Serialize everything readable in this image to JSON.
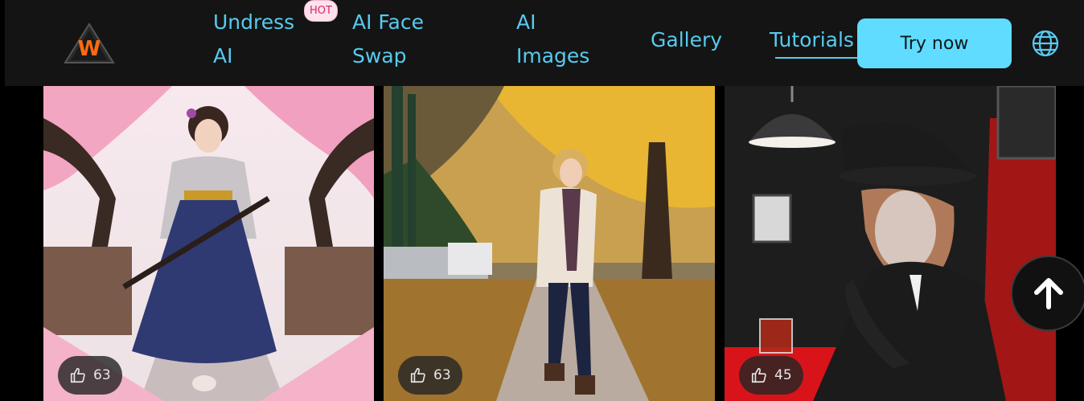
{
  "nav": {
    "logo_icon": "w-triangle-logo",
    "links": {
      "undress_line1": "Undress",
      "undress_line2": "AI",
      "hot_badge": "HOT",
      "faceswap_line1": "AI Face",
      "faceswap_line2": "Swap",
      "images_line1": "AI",
      "images_line2": "Images",
      "gallery": "Gallery",
      "tutorials": "Tutorials"
    },
    "try_now": "Try now",
    "language_icon": "globe-icon"
  },
  "cards": [
    {
      "likes": "63",
      "icon": "thumbs-up-icon"
    },
    {
      "likes": "63",
      "icon": "thumbs-up-icon"
    },
    {
      "likes": "45",
      "icon": "thumbs-up-icon"
    }
  ],
  "scroll_top_icon": "arrow-up-icon",
  "colors": {
    "accent": "#56cbef",
    "button": "#5fdcff",
    "hot": "#d6266c"
  }
}
